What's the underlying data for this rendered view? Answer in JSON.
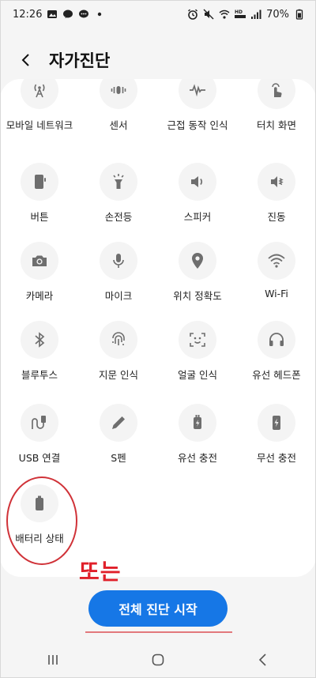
{
  "status_bar": {
    "time": "12:26",
    "battery": "70%",
    "left_icons": [
      "gallery-icon",
      "messenger-icon",
      "chat-icon",
      "dot-icon"
    ],
    "right_icons": [
      "alarm-icon",
      "mute-icon",
      "wifi-icon",
      "hd-voice-icon",
      "signal-icon"
    ]
  },
  "header": {
    "title": "자가진단"
  },
  "tests": [
    {
      "label": "모바일 네트워크",
      "icon": "mobile-network-icon"
    },
    {
      "label": "센서",
      "icon": "sensor-icon"
    },
    {
      "label": "근접 동작 인식",
      "icon": "proximity-icon"
    },
    {
      "label": "터치 화면",
      "icon": "touch-icon"
    },
    {
      "label": "버튼",
      "icon": "button-icon"
    },
    {
      "label": "손전등",
      "icon": "flashlight-icon"
    },
    {
      "label": "스피커",
      "icon": "speaker-icon"
    },
    {
      "label": "진동",
      "icon": "vibration-icon"
    },
    {
      "label": "카메라",
      "icon": "camera-icon"
    },
    {
      "label": "마이크",
      "icon": "microphone-icon"
    },
    {
      "label": "위치 정확도",
      "icon": "location-icon"
    },
    {
      "label": "Wi-Fi",
      "icon": "wifi-icon"
    },
    {
      "label": "블루투스",
      "icon": "bluetooth-icon"
    },
    {
      "label": "지문 인식",
      "icon": "fingerprint-icon"
    },
    {
      "label": "얼굴 인식",
      "icon": "face-icon"
    },
    {
      "label": "유선 헤드폰",
      "icon": "headphone-icon"
    },
    {
      "label": "USB 연결",
      "icon": "usb-icon"
    },
    {
      "label": "S펜",
      "icon": "spen-icon"
    },
    {
      "label": "유선 충전",
      "icon": "wired-charging-icon"
    },
    {
      "label": "무선 충전",
      "icon": "wireless-charging-icon"
    },
    {
      "label": "배터리 상태",
      "icon": "battery-icon"
    }
  ],
  "annotation": {
    "text": "또는",
    "color": "#e0202a"
  },
  "actions": {
    "start_all_label": "전체 진단 시작"
  },
  "colors": {
    "accent": "#1677e6",
    "icon_gray": "#6e6e6e",
    "highlight_ring": "#d03238"
  }
}
